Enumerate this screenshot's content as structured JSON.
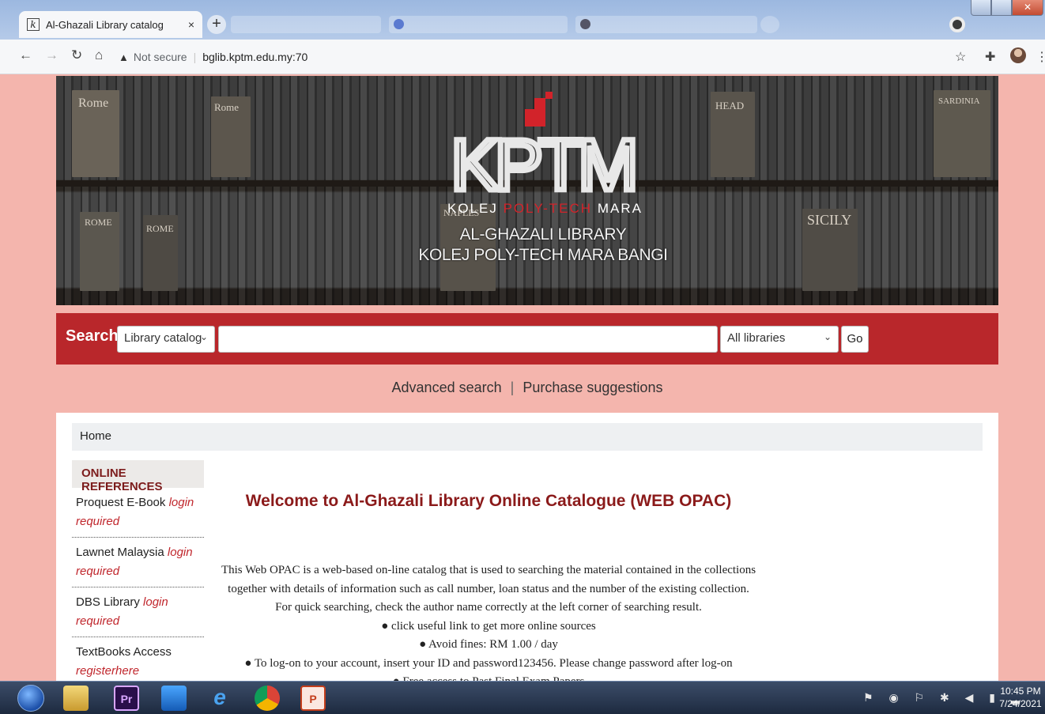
{
  "browser": {
    "tab_title": "Al-Ghazali Library catalog",
    "favicon_letter": "k",
    "tab_close": "×",
    "new_tab": "+",
    "security_label": "Not secure",
    "url": "bglib.kptm.edu.my:70"
  },
  "banner": {
    "logo_text": "KPTM",
    "logo_sub_1": "KOLEJ",
    "logo_sub_2": "POLY-TECH",
    "logo_sub_3": "MARA",
    "library_line_1": "AL-GHAZALI LIBRARY",
    "library_line_2": "KOLEJ POLY-TECH MARA BANGI",
    "book_labels": [
      "Rome",
      "Rome",
      "ROME",
      "ROME",
      "NAPLES",
      "HEAD",
      "SICILY",
      "SARDINIA"
    ]
  },
  "search": {
    "label": "Search",
    "catalog_select": "Library catalog",
    "query_value": "",
    "library_select": "All libraries",
    "go_label": "Go"
  },
  "links": {
    "advanced": "Advanced search",
    "separator": "|",
    "purchase": "Purchase suggestions"
  },
  "breadcrumb": {
    "home": "Home"
  },
  "sidebar": {
    "heading": "ONLINE REFERENCES",
    "items": [
      {
        "name": "Proquest E-Book",
        "note": "login required"
      },
      {
        "name": "Lawnet Malaysia",
        "note": "login required"
      },
      {
        "name": "DBS Library",
        "note": "login required"
      },
      {
        "name": "TextBooks Access",
        "note": "registerhere"
      }
    ]
  },
  "main": {
    "welcome": "Welcome to Al-Ghazali Library Online Catalogue (WEB OPAC)",
    "lines": [
      "This Web OPAC is a web-based on-line catalog that is used to searching the material contained in the collections",
      "together with details of information such as call number, loan status and the number of the existing collection.",
      "For quick searching, check the author name correctly at the left corner of searching result.",
      "● click useful link to get more online sources",
      "● Avoid fines: RM 1.00 / day",
      "● To log-on to your account, insert your ID and password123456. Please change password after log-on",
      "● Free access to Past Final Exam Papers"
    ]
  },
  "taskbar": {
    "time": "10:45 PM",
    "date": "7/24/2021"
  },
  "colors": {
    "page_bg": "#f4b5ad",
    "search_bar": "#b9272b",
    "welcome_heading": "#8b1a1a",
    "login_note": "#c0262c"
  }
}
